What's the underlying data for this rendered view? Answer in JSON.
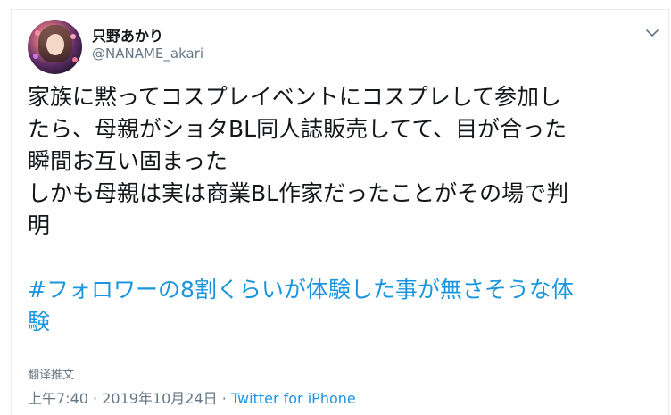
{
  "user": {
    "display_name": "只野あかり",
    "handle": "@NANAME_akari"
  },
  "tweet": {
    "lines": [
      "家族に黙ってコスプレイベントにコスプレして参加し",
      "たら、母親がショタBL同人誌販売してて、目が合った",
      "瞬間お互い固まった",
      "しかも母親は実は商業BL作家だったことがその場で判",
      "明"
    ],
    "hashtag_lines": [
      "#フォロワーの8割くらいが体験した事が無さそうな体",
      "験"
    ]
  },
  "translate_label": "翻译推文",
  "meta": {
    "time": "上午7:40",
    "separator_1": " · ",
    "date": "2019年10月24日",
    "separator_2": " · ",
    "source": "Twitter for iPhone"
  },
  "colors": {
    "text": "#14171a",
    "muted": "#657786",
    "link": "#1b95e0",
    "border": "#e6ecf0"
  },
  "icons": {
    "more": "chevron-down-icon"
  }
}
